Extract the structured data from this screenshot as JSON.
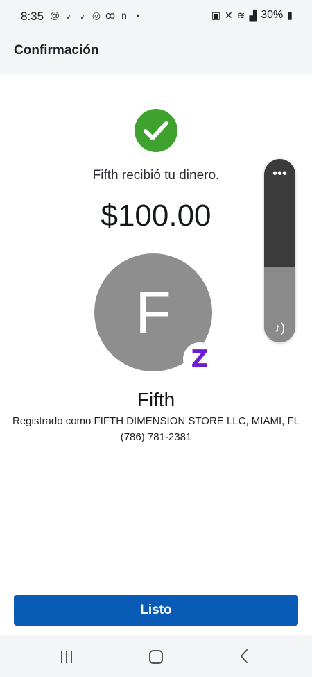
{
  "status_bar": {
    "time": "8:35",
    "left_icons": [
      "threads-icon",
      "tiktok-icon",
      "tiktok-icon",
      "instagram-icon",
      "voicemail-icon",
      "notification-n-icon",
      "dot-icon"
    ],
    "right_icons": [
      "battery-saver-icon",
      "mute-icon",
      "wifi-icon",
      "signal-icon"
    ],
    "battery_text": "30%"
  },
  "header": {
    "title": "Confirmación"
  },
  "confirmation": {
    "message": "Fifth recibió tu dinero.",
    "amount": "$100.00"
  },
  "recipient": {
    "initial": "F",
    "badge_letter": "Z",
    "name": "Fifth",
    "registered": "Registrado como FIFTH DIMENSION STORE LLC, MIAMI, FL",
    "phone": "(786) 781-2381"
  },
  "volume_panel": {
    "more_label": "•••",
    "level": 0.41,
    "icon": "music-note-icon"
  },
  "footer": {
    "done_label": "Listo"
  },
  "colors": {
    "accent_blue": "#0a5bb6",
    "success_green": "#3fa22f",
    "zelle_purple": "#6d1ed4",
    "avatar_gray": "#8e8e8e"
  }
}
